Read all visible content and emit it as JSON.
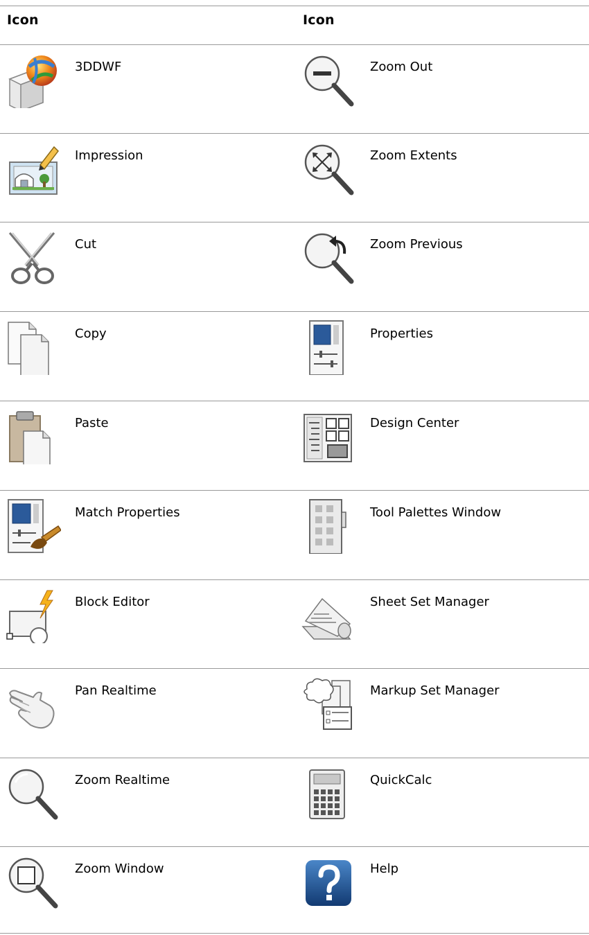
{
  "header": {
    "left": "Icon",
    "right": "Icon"
  },
  "rows": [
    {
      "left": {
        "label": "3DDWF",
        "icon": "3ddwf-icon"
      },
      "right": {
        "label": "Zoom Out",
        "icon": "zoom-out-icon"
      }
    },
    {
      "left": {
        "label": "Impression",
        "icon": "impression-icon"
      },
      "right": {
        "label": "Zoom Extents",
        "icon": "zoom-extents-icon"
      }
    },
    {
      "left": {
        "label": "Cut",
        "icon": "scissors-icon"
      },
      "right": {
        "label": "Zoom Previous",
        "icon": "zoom-previous-icon"
      }
    },
    {
      "left": {
        "label": "Copy",
        "icon": "copy-icon"
      },
      "right": {
        "label": "Properties",
        "icon": "properties-icon"
      }
    },
    {
      "left": {
        "label": "Paste",
        "icon": "paste-icon"
      },
      "right": {
        "label": "Design Center",
        "icon": "design-center-icon"
      }
    },
    {
      "left": {
        "label": "Match Properties",
        "icon": "match-properties-icon"
      },
      "right": {
        "label": "Tool Palettes Window",
        "icon": "tool-palettes-icon"
      }
    },
    {
      "left": {
        "label": "Block Editor",
        "icon": "block-editor-icon"
      },
      "right": {
        "label": "Sheet Set Manager",
        "icon": "sheet-set-manager-icon"
      }
    },
    {
      "left": {
        "label": "Pan Realtime",
        "icon": "pan-hand-icon"
      },
      "right": {
        "label": "Markup Set Manager",
        "icon": "markup-set-manager-icon"
      }
    },
    {
      "left": {
        "label": "Zoom Realtime",
        "icon": "zoom-realtime-icon"
      },
      "right": {
        "label": "QuickCalc",
        "icon": "calculator-icon"
      }
    },
    {
      "left": {
        "label": "Zoom Window",
        "icon": "zoom-window-icon"
      },
      "right": {
        "label": "Help",
        "icon": "help-icon"
      }
    }
  ]
}
